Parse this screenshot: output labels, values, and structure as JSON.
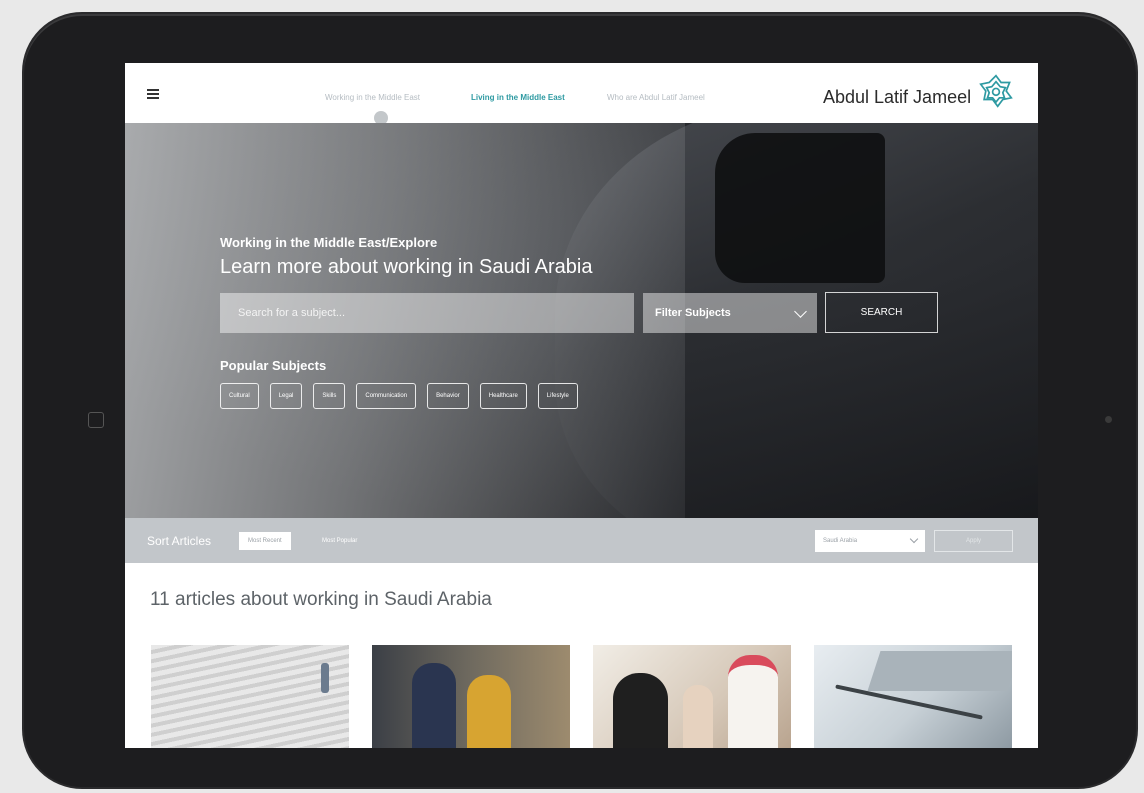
{
  "nav": {
    "items": [
      {
        "label": "Working in the Middle East"
      },
      {
        "label": "Living in the Middle East"
      },
      {
        "label": "Who are Abdul Latif Jameel"
      }
    ],
    "brand": "Abdul Latif Jameel",
    "menu_icon": "hamburger-menu-icon"
  },
  "hero": {
    "breadcrumb": "Working in the Middle East/Explore",
    "title": "Learn more about working in Saudi Arabia",
    "search_placeholder": "Search for a subject...",
    "filter_label": "Filter Subjects",
    "search_button": "SEARCH",
    "popular_title": "Popular Subjects",
    "chips": [
      "Cultural",
      "Legal",
      "Skills",
      "Communication",
      "Behavior",
      "Healthcare",
      "Lifestyle"
    ]
  },
  "sort": {
    "label": "Sort Articles",
    "options": [
      "Most Recent",
      "Most Popular"
    ],
    "country": "Saudi Arabia",
    "apply": "Apply"
  },
  "articles": {
    "heading": "11 articles about working in Saudi Arabia"
  },
  "colors": {
    "accent": "#2e9aa2",
    "sortbar": "#c2c6ca",
    "heading": "#5d6368"
  }
}
